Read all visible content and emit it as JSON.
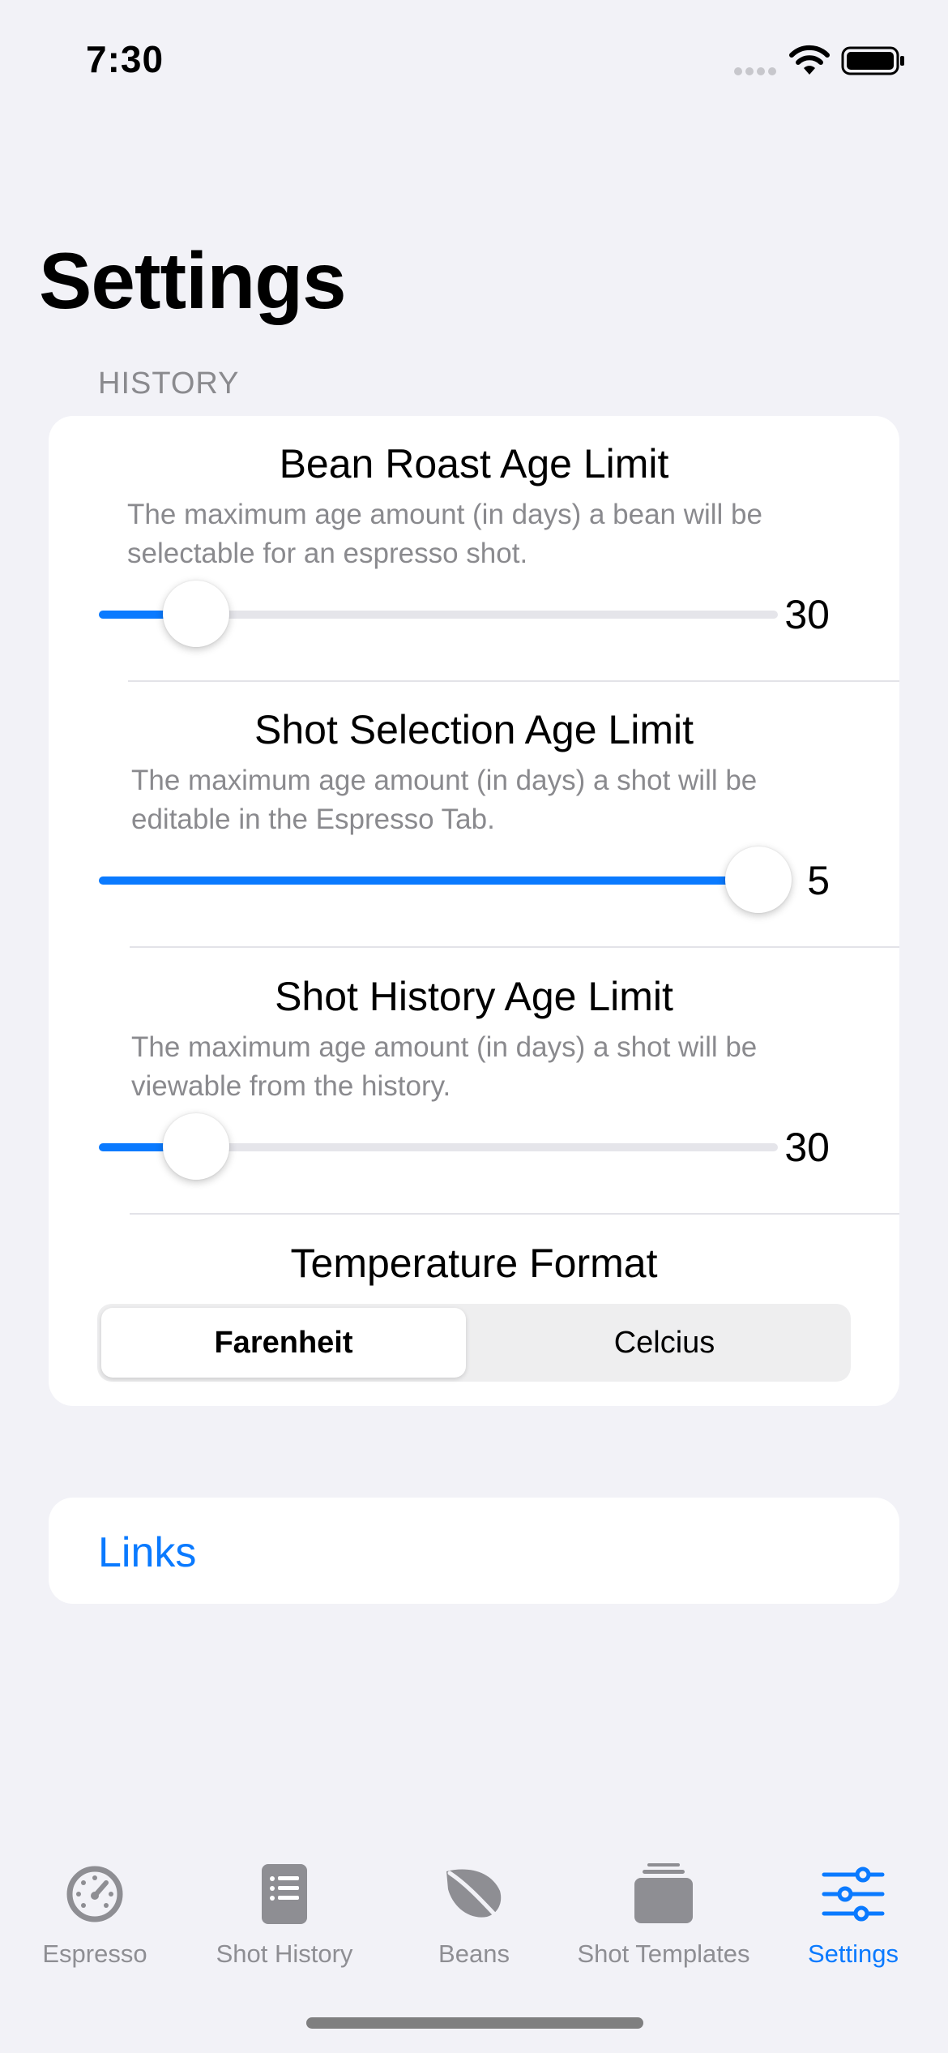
{
  "status_bar": {
    "time": "7:30"
  },
  "page_title": "Settings",
  "history_section": {
    "header": "HISTORY",
    "bean_roast": {
      "title": "Bean Roast Age Limit",
      "description": "The maximum age amount (in days) a bean will be selectable for an espresso shot.",
      "value": "30",
      "fraction": 0.117
    },
    "shot_selection": {
      "title": "Shot Selection Age Limit",
      "description": "The maximum age amount (in days) a shot will be editable in the Espresso Tab.",
      "value": "5",
      "fraction": 1.0
    },
    "shot_history": {
      "title": "Shot History Age Limit",
      "description": "The maximum age amount (in days) a shot will be viewable from the history.",
      "value": "30",
      "fraction": 0.117
    },
    "temperature": {
      "title": "Temperature Format",
      "options": [
        "Farenheit",
        "Celcius"
      ],
      "selected": "Farenheit"
    }
  },
  "links": {
    "label": "Links"
  },
  "tab_bar": {
    "tabs": [
      {
        "label": "Espresso",
        "icon": "gauge-icon",
        "active": false
      },
      {
        "label": "Shot History",
        "icon": "list-icon",
        "active": false
      },
      {
        "label": "Beans",
        "icon": "leaf-icon",
        "active": false
      },
      {
        "label": "Shot Templates",
        "icon": "stack-icon",
        "active": false
      },
      {
        "label": "Settings",
        "icon": "sliders-icon",
        "active": true
      }
    ]
  },
  "colors": {
    "accent": "#0A7AFF",
    "background": "#F2F2F7",
    "secondary_text": "#8A8A8E",
    "inactive_tab": "#8E8E93"
  }
}
